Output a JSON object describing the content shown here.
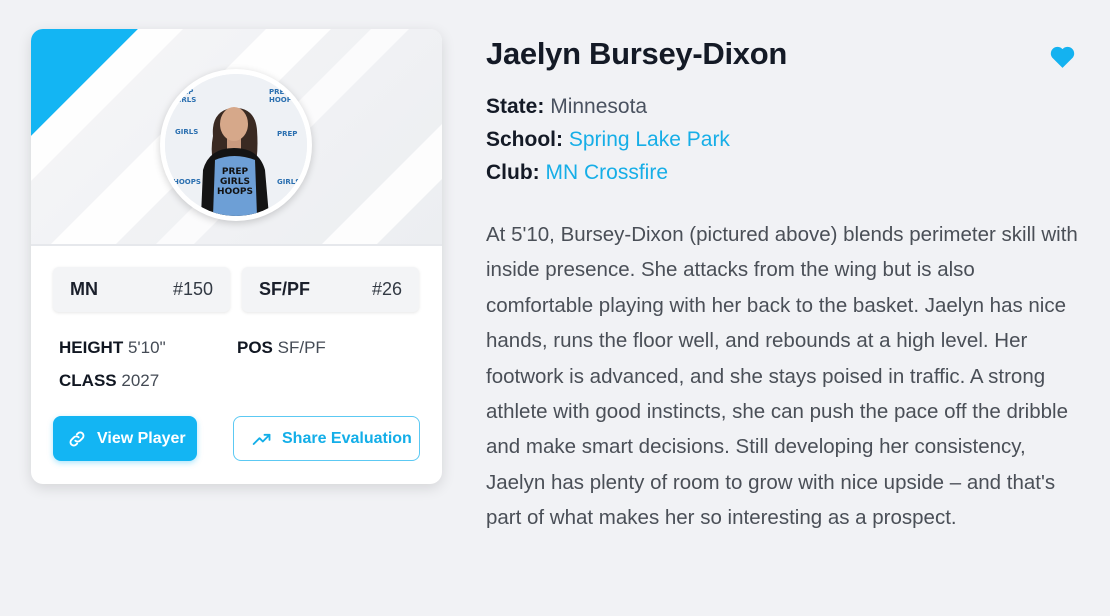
{
  "player": {
    "name": "Jaelyn Bursey-Dixon",
    "state_label": "State:",
    "state": "Minnesota",
    "school_label": "School:",
    "school": "Spring Lake Park",
    "club_label": "Club:",
    "club": "MN Crossfire",
    "description": "At 5'10, Bursey-Dixon (pictured above) blends perimeter skill with inside presence. She attacks from the wing but is also comfortable playing with her back to the basket. Jaelyn has nice hands, runs the floor well, and rebounds at a high level. Her footwork is advanced, and she stays poised in traffic. A strong athlete with good instincts, she can push the pace off the dribble and make smart decisions. Still developing her consistency, Jaelyn has plenty of room to grow with nice upside – and that's part of what makes her so interesting as a prospect."
  },
  "card": {
    "state_rank": {
      "label": "MN",
      "value": "#150"
    },
    "position_rank": {
      "label": "SF/PF",
      "value": "#26"
    },
    "height_label": "HEIGHT",
    "height": "5'10\"",
    "pos_label": "POS",
    "pos": "SF/PF",
    "class_label": "CLASS",
    "class_year": "2027",
    "view_button": "View Player",
    "share_button": "Share Evaluation",
    "photo_jersey_text": [
      "PREP",
      "GIRLS",
      "HOOPS"
    ],
    "backdrop_logo_text": [
      "PREP",
      "GIRLS",
      "HOOPS"
    ]
  },
  "icons": {
    "favorite": "heart-icon",
    "view": "link-icon",
    "share": "trending-up-icon"
  },
  "colors": {
    "accent": "#13b5f3",
    "heart": "#14b2f0",
    "title": "#141a26",
    "body_text": "#4a4f57"
  }
}
